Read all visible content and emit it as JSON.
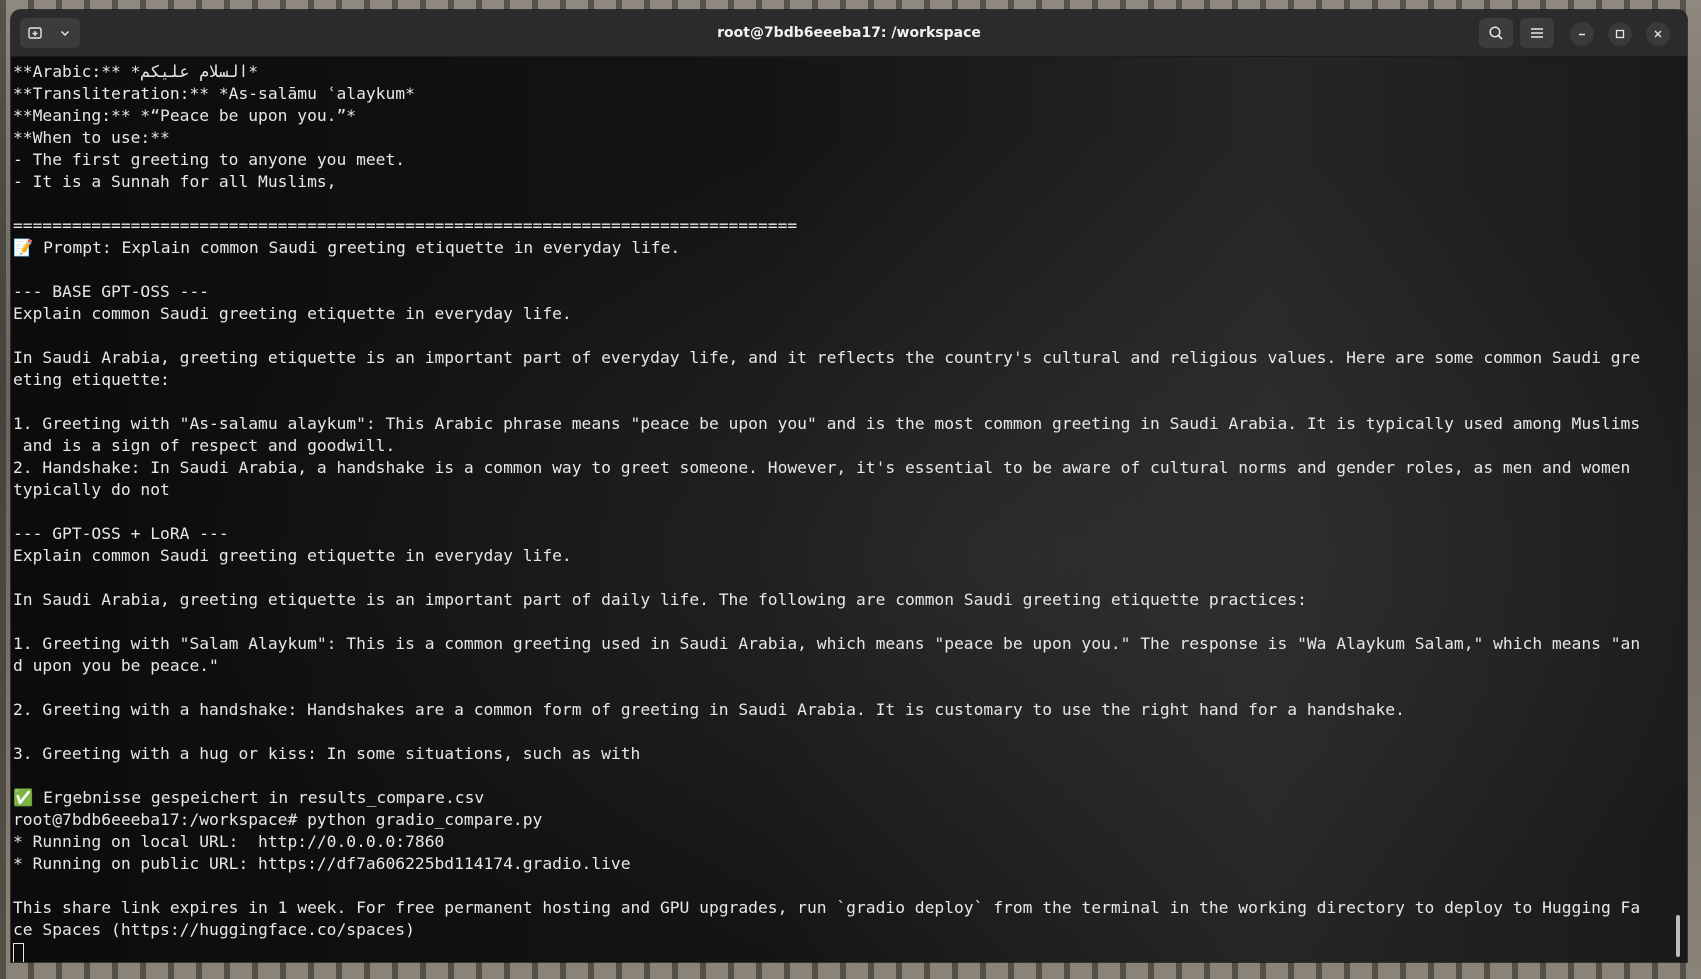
{
  "window": {
    "title": "root@7bdb6eeeba17: /workspace"
  },
  "titlebar": {
    "new_tab_icon": "terminal-new-tab-icon",
    "dropdown_icon": "chevron-down-icon",
    "search_icon": "search-icon",
    "menu_icon": "hamburger-menu-icon",
    "minimize_icon": "minimize-icon",
    "maximize_icon": "maximize-icon",
    "close_icon": "close-icon"
  },
  "terminal": {
    "lines": [
      "**Arabic:** *السلام عليكم*",
      "**Transliteration:** *As-salāmu ʿalaykum*",
      "**Meaning:** *“Peace be upon you.”*",
      "**When to use:**",
      "- The first greeting to anyone you meet.",
      "- It is a Sunnah for all Muslims,",
      "",
      "================================================================================",
      "📝 Prompt: Explain common Saudi greeting etiquette in everyday life.",
      "",
      "--- BASE GPT-OSS ---",
      "Explain common Saudi greeting etiquette in everyday life.",
      "",
      "In Saudi Arabia, greeting etiquette is an important part of everyday life, and it reflects the country's cultural and religious values. Here are some common Saudi gre",
      "eting etiquette:",
      "",
      "1. Greeting with \"As-salamu alaykum\": This Arabic phrase means \"peace be upon you\" and is the most common greeting in Saudi Arabia. It is typically used among Muslims",
      " and is a sign of respect and goodwill.",
      "2. Handshake: In Saudi Arabia, a handshake is a common way to greet someone. However, it's essential to be aware of cultural norms and gender roles, as men and women",
      "typically do not",
      "",
      "--- GPT-OSS + LoRA ---",
      "Explain common Saudi greeting etiquette in everyday life.",
      "",
      "In Saudi Arabia, greeting etiquette is an important part of daily life. The following are common Saudi greeting etiquette practices:",
      "",
      "1. Greeting with \"Salam Alaykum\": This is a common greeting used in Saudi Arabia, which means \"peace be upon you.\" The response is \"Wa Alaykum Salam,\" which means \"an",
      "d upon you be peace.\"",
      "",
      "2. Greeting with a handshake: Handshakes are a common form of greeting in Saudi Arabia. It is customary to use the right hand for a handshake.",
      "",
      "3. Greeting with a hug or kiss: In some situations, such as with",
      "",
      "✅ Ergebnisse gespeichert in results_compare.csv",
      "root@7bdb6eeeba17:/workspace# python gradio_compare.py",
      "* Running on local URL:  http://0.0.0.0:7860",
      "* Running on public URL: https://df7a606225bd114174.gradio.live",
      "",
      "This share link expires in 1 week. For free permanent hosting and GPU upgrades, run `gradio deploy` from the terminal in the working directory to deploy to Hugging Fa",
      "ce Spaces (https://huggingface.co/spaces)"
    ]
  }
}
